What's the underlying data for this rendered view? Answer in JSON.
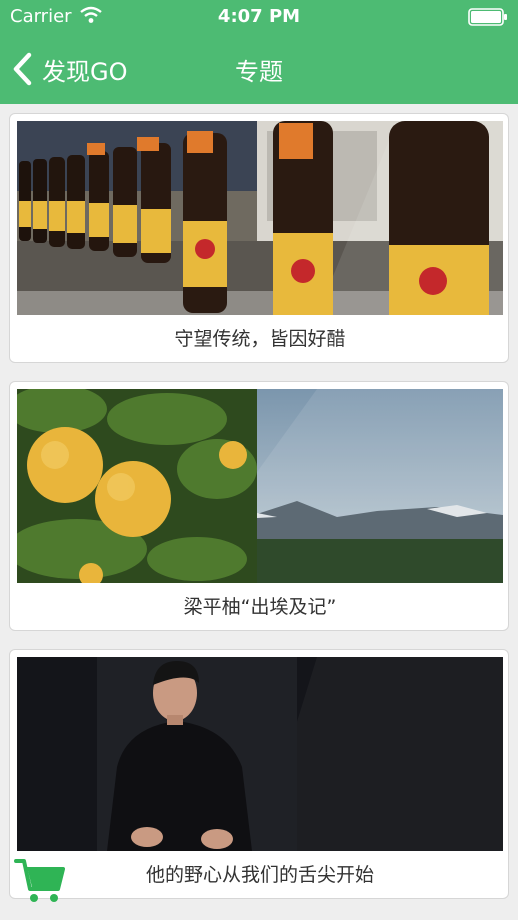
{
  "status_bar": {
    "carrier": "Carrier",
    "time": "4:07 PM"
  },
  "nav": {
    "back_label": "发现GO",
    "title": "专题"
  },
  "topics": [
    {
      "caption": "守望传统，皆因好醋",
      "image": "vinegar-bottles-photo"
    },
    {
      "caption": "梁平柚“出埃及记”",
      "image": "pomelo-mountains-photo"
    },
    {
      "caption": "他的野心从我们的舌尖开始",
      "image": "man-portrait-photo"
    }
  ],
  "colors": {
    "accent": "#4dbb73",
    "background": "#eeeeee",
    "card": "#ffffff",
    "caption": "#333333"
  },
  "icons": [
    "wifi-icon",
    "battery-icon",
    "back-chevron-icon",
    "cart-icon"
  ]
}
